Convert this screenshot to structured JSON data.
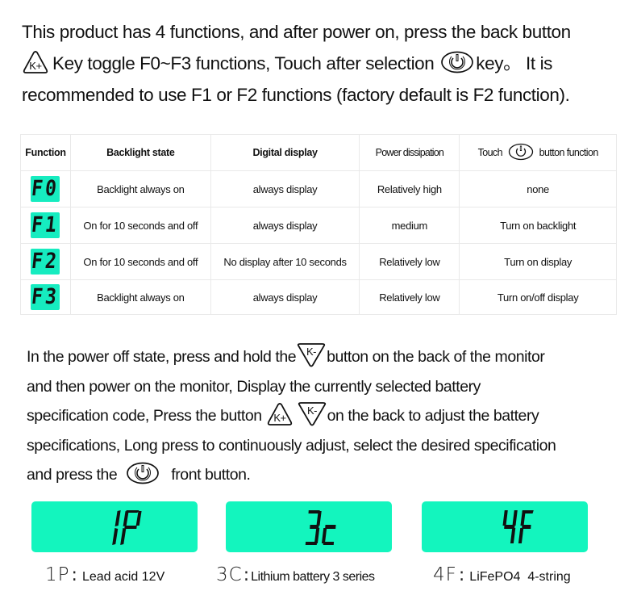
{
  "intro": {
    "line1": "This product has 4 functions, and after power on, press the back button",
    "line2_after_icon": "Key toggle F0~F3 functions,   Touch after selection",
    "line2_end": "key。 It is",
    "line3": "recommended to use F1 or F2 functions (factory default is F2 function)."
  },
  "icons": {
    "k_plus": "key-plus-icon",
    "k_minus": "key-minus-icon",
    "power": "power-button-icon",
    "k_plus_label": "K+",
    "k_minus_label": "K-"
  },
  "table": {
    "headers": {
      "function": "Function",
      "backlight": "Backlight state",
      "digital": "Digital display",
      "power": "Power dissipation",
      "touch_prefix": "Touch",
      "touch_suffix": "button function"
    },
    "rows": [
      {
        "function": "F0",
        "backlight": "Backlight always on",
        "digital": "always display",
        "power": "Relatively high",
        "touch": "none"
      },
      {
        "function": "F1",
        "backlight": "On for 10 seconds and off",
        "digital": "always display",
        "power": "medium",
        "touch": "Turn on backlight"
      },
      {
        "function": "F2",
        "backlight": "On for 10 seconds and off",
        "digital": "No display after 10 seconds",
        "power": "Relatively low",
        "touch": "Turn on display"
      },
      {
        "function": "F3",
        "backlight": "Backlight always on",
        "digital": "always display",
        "power": "Relatively low",
        "touch": "Turn on/off display"
      }
    ]
  },
  "howto": {
    "line1_a": "In the power off state, press and hold the",
    "line1_b": "button on the back of the monitor",
    "line2": "and then power on the monitor,   Display the currently selected battery",
    "line3_a": "specification code,   Press the button",
    "line3_b": "on the back to adjust the battery",
    "line4": "specifications,   Long press to continuously adjust, select the desired specification",
    "line5_a": "and press the",
    "line5_b": "front button."
  },
  "specs": [
    {
      "display": "1P",
      "code": "1P",
      "desc": "Lead acid 12V"
    },
    {
      "display": "3c",
      "code": "3C",
      "desc": "Lithium battery 3 series"
    },
    {
      "display": "4F",
      "code": "4F",
      "desc": "LiFePO4  4-string"
    }
  ],
  "colors": {
    "lcd_green": "#13f5be",
    "badge_green": "#16ecc0",
    "text": "#111111",
    "table_border": "#e9e9e9"
  }
}
